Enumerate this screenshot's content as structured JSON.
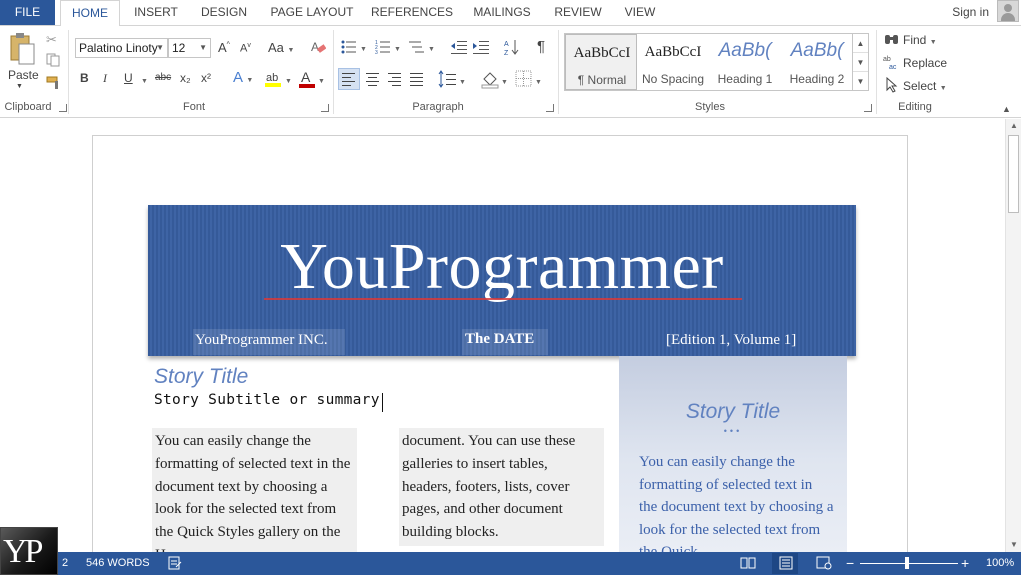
{
  "tabs": [
    {
      "label": "FILE",
      "x": 0
    },
    {
      "label": "HOME"
    },
    {
      "label": "INSERT"
    },
    {
      "label": "DESIGN"
    },
    {
      "label": "PAGE LAYOUT"
    },
    {
      "label": "REFERENCES"
    },
    {
      "label": "MAILINGS"
    },
    {
      "label": "REVIEW"
    },
    {
      "label": "VIEW"
    }
  ],
  "account": {
    "signin": "Sign in"
  },
  "clipboard": {
    "paste": "Paste",
    "label": "Clipboard"
  },
  "font": {
    "family": "Palatino Linoty",
    "size": "12",
    "label": "Font",
    "bold": "B",
    "italic": "I",
    "underline": "U",
    "strike": "abc",
    "sub": "x₂",
    "sup": "x²",
    "case": "Aa",
    "grow": "A",
    "shrink": "A",
    "color_letter": "A",
    "text_effects": "A",
    "font_color": "#c00000",
    "highlight_color": "#ffff00"
  },
  "paragraph": {
    "label": "Paragraph",
    "pilcrow": "¶"
  },
  "styles": {
    "label": "Styles",
    "items": [
      {
        "sample": "AaBbCcI",
        "name": "¶ Normal"
      },
      {
        "sample": "AaBbCcI",
        "name": "No Spacing"
      },
      {
        "sample": "AaBb(",
        "name": "Heading 1"
      },
      {
        "sample": "AaBb(",
        "name": "Heading 2"
      }
    ]
  },
  "editing": {
    "label": "Editing",
    "find": "Find",
    "replace": "Replace",
    "select": "Select"
  },
  "document": {
    "banner_title": "YouProgrammer",
    "company": "YouProgrammer INC.",
    "date": "The DATE",
    "edition": "[Edition 1, Volume 1]",
    "story_title": "Story Title",
    "story_subtitle": "Story Subtitle or summary",
    "col1_text": "You can easily change the formatting of selected text in the document text by choosing a look for the selected text from the Quick Styles gallery on the Home",
    "col2_text": "document. You can use these galleries to insert tables, headers, footers, lists, cover pages, and other document building blocks.",
    "sidebar_title": "Story Title",
    "sidebar_dots": "•••",
    "sidebar_text": "You can easily change the formatting of selected text in the document text by choosing a look for the selected text from the Quick"
  },
  "status": {
    "page": "2",
    "words": "546 WORDS",
    "zoom": "100%",
    "minus": "−",
    "plus": "+"
  },
  "colors": {
    "accent": "#2b579a",
    "banner": "#3a5fa1",
    "story_title": "#6182c0"
  },
  "logo": {
    "text": "YP"
  }
}
